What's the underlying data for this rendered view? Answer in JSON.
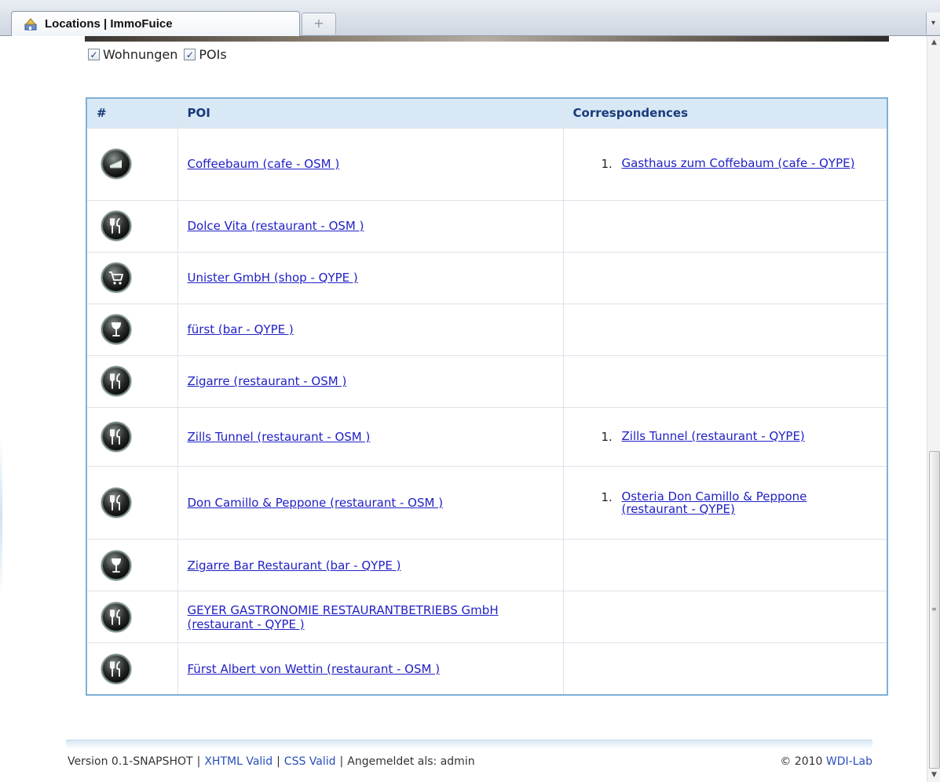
{
  "browser": {
    "tab_title": "Locations | ImmoFuice",
    "new_tab_glyph": "+",
    "tab_scroll_glyph": "▾"
  },
  "filters": [
    {
      "label": "Wohnungen",
      "checked": true
    },
    {
      "label": "POIs",
      "checked": true
    }
  ],
  "table": {
    "headers": {
      "num": "#",
      "poi": "POI",
      "corr": "Correspondences"
    },
    "rows": [
      {
        "icon": "cafe-icon",
        "poi": "Coffeebaum (cafe - OSM )",
        "correspondences": [
          "Gasthaus zum Coffebaum (cafe - QYPE)"
        ]
      },
      {
        "icon": "restaurant-icon",
        "poi": "Dolce Vita (restaurant - OSM )",
        "correspondences": []
      },
      {
        "icon": "shop-icon",
        "poi": "Unister GmbH (shop - QYPE )",
        "correspondences": []
      },
      {
        "icon": "bar-icon",
        "poi": "fürst (bar - QYPE )",
        "correspondences": []
      },
      {
        "icon": "restaurant-icon",
        "poi": "Zigarre (restaurant - OSM )",
        "correspondences": []
      },
      {
        "icon": "restaurant-icon",
        "poi": "Zills Tunnel (restaurant - OSM )",
        "correspondences": [
          "Zills Tunnel (restaurant - QYPE)"
        ]
      },
      {
        "icon": "restaurant-icon",
        "poi": "Don Camillo & Peppone (restaurant - OSM )",
        "correspondences": [
          "Osteria Don Camillo & Peppone (restaurant - QYPE)"
        ]
      },
      {
        "icon": "bar-icon",
        "poi": "Zigarre Bar Restaurant (bar - QYPE )",
        "correspondences": []
      },
      {
        "icon": "restaurant-icon",
        "poi": "GEYER GASTRONOMIE RESTAURANTBETRIEBS GmbH (restaurant - QYPE )",
        "correspondences": []
      },
      {
        "icon": "restaurant-icon",
        "poi": "Fürst Albert von Wettin (restaurant - OSM )",
        "correspondences": []
      }
    ]
  },
  "footer": {
    "version": "Version 0.1-SNAPSHOT",
    "xhtml": "XHTML Valid",
    "css": "CSS Valid",
    "logged_in": "Angemeldet als: admin",
    "copyright_prefix": "© 2010",
    "copyright_link": "WDI-Lab"
  },
  "colors": {
    "link": "#2121c6",
    "header_bg": "#d8e8f5",
    "table_border": "#7fb0d8"
  }
}
